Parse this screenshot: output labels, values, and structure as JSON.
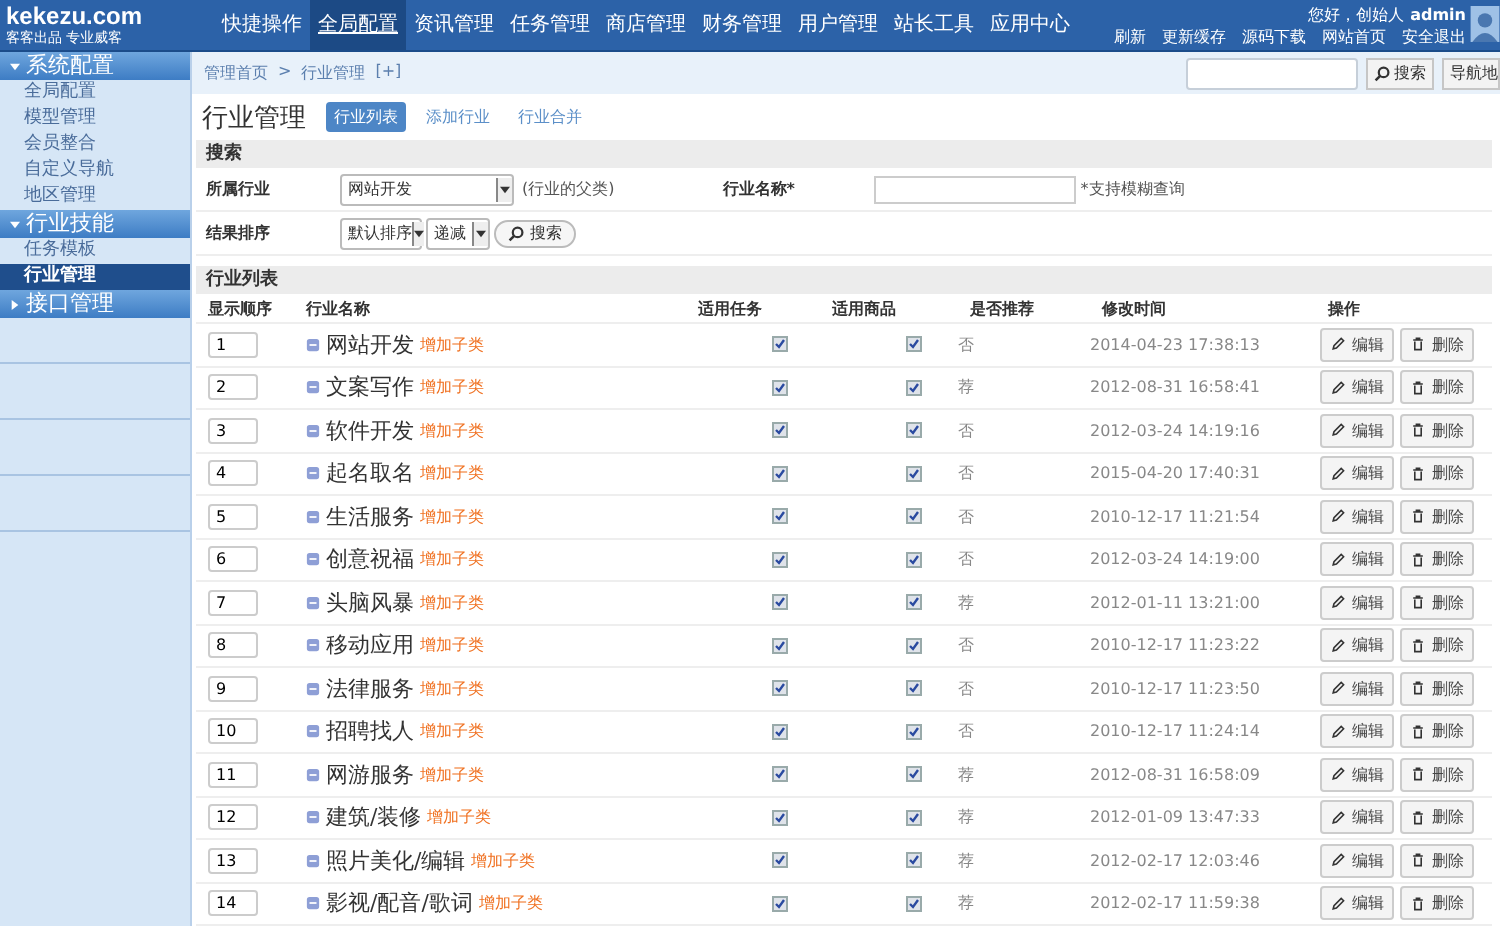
{
  "header": {
    "logo": {
      "name": "kekezu.com",
      "tagline": "客客出品 专业威客"
    },
    "nav": [
      {
        "label": "快捷操作",
        "selected": false
      },
      {
        "label": "全局配置",
        "selected": true
      },
      {
        "label": "资讯管理",
        "selected": false
      },
      {
        "label": "任务管理",
        "selected": false
      },
      {
        "label": "商店管理",
        "selected": false
      },
      {
        "label": "财务管理",
        "selected": false
      },
      {
        "label": "用户管理",
        "selected": false
      },
      {
        "label": "站长工具",
        "selected": false
      },
      {
        "label": "应用中心",
        "selected": false
      }
    ],
    "greeting": "您好，创始人",
    "user": "admin",
    "links": [
      "刷新",
      "更新缓存",
      "源码下载",
      "网站首页",
      "安全退出"
    ]
  },
  "sidebar": [
    {
      "title": "系统配置",
      "expanded": true,
      "items": [
        {
          "label": "全局配置",
          "selected": false
        },
        {
          "label": "模型管理",
          "selected": false
        },
        {
          "label": "会员整合",
          "selected": false
        },
        {
          "label": "自定义导航",
          "selected": false
        },
        {
          "label": "地区管理",
          "selected": false
        }
      ]
    },
    {
      "title": "行业技能",
      "expanded": true,
      "items": [
        {
          "label": "任务模板",
          "selected": false
        },
        {
          "label": "行业管理",
          "selected": true
        }
      ]
    },
    {
      "title": "接口管理",
      "expanded": false
    }
  ],
  "breadcrumb": {
    "items": [
      "管理首页",
      "行业管理"
    ],
    "separator": ">",
    "add": "[+]"
  },
  "top_search": {
    "button": "搜索",
    "nav_button": "导航地"
  },
  "page": {
    "title": "行业管理",
    "tabs": [
      {
        "label": "行业列表",
        "selected": true
      },
      {
        "label": "添加行业",
        "selected": false
      },
      {
        "label": "行业合并",
        "selected": false
      }
    ]
  },
  "search": {
    "title": "搜索",
    "industry_label": "所属行业",
    "industry_value": "网站开发",
    "industry_hint": "(行业的父类)",
    "name_label": "行业名称*",
    "name_hint": "*支持模糊查询",
    "sort_label": "结果排序",
    "sort_value": "默认排序",
    "order_value": "递减",
    "button": "搜索"
  },
  "list": {
    "title": "行业列表",
    "columns": [
      "显示顺序",
      "行业名称",
      "适用任务",
      "适用商品",
      "是否推荐",
      "修改时间",
      "操作"
    ],
    "rows": [
      {
        "order": "1",
        "name": "网站开发",
        "add_child": "增加子类",
        "task": true,
        "goods": true,
        "recommend": "否",
        "time": "2014-04-23 17:38:13",
        "edit": "编辑",
        "delete": "删除"
      },
      {
        "order": "2",
        "name": "文案写作",
        "add_child": "增加子类",
        "task": true,
        "goods": true,
        "recommend": "荐",
        "time": "2012-08-31 16:58:41",
        "edit": "编辑",
        "delete": "删除"
      },
      {
        "order": "3",
        "name": "软件开发",
        "add_child": "增加子类",
        "task": true,
        "goods": true,
        "recommend": "否",
        "time": "2012-03-24 14:19:16",
        "edit": "编辑",
        "delete": "删除"
      },
      {
        "order": "4",
        "name": "起名取名",
        "add_child": "增加子类",
        "task": true,
        "goods": true,
        "recommend": "否",
        "time": "2015-04-20 17:40:31",
        "edit": "编辑",
        "delete": "删除"
      },
      {
        "order": "5",
        "name": "生活服务",
        "add_child": "增加子类",
        "task": true,
        "goods": true,
        "recommend": "否",
        "time": "2010-12-17 11:21:54",
        "edit": "编辑",
        "delete": "删除"
      },
      {
        "order": "6",
        "name": "创意祝福",
        "add_child": "增加子类",
        "task": true,
        "goods": true,
        "recommend": "否",
        "time": "2012-03-24 14:19:00",
        "edit": "编辑",
        "delete": "删除"
      },
      {
        "order": "7",
        "name": "头脑风暴",
        "add_child": "增加子类",
        "task": true,
        "goods": true,
        "recommend": "荐",
        "time": "2012-01-11 13:21:00",
        "edit": "编辑",
        "delete": "删除"
      },
      {
        "order": "8",
        "name": "移动应用",
        "add_child": "增加子类",
        "task": true,
        "goods": true,
        "recommend": "否",
        "time": "2010-12-17 11:23:22",
        "edit": "编辑",
        "delete": "删除"
      },
      {
        "order": "9",
        "name": "法律服务",
        "add_child": "增加子类",
        "task": true,
        "goods": true,
        "recommend": "否",
        "time": "2010-12-17 11:23:50",
        "edit": "编辑",
        "delete": "删除"
      },
      {
        "order": "10",
        "name": "招聘找人",
        "add_child": "增加子类",
        "task": true,
        "goods": true,
        "recommend": "否",
        "time": "2010-12-17 11:24:14",
        "edit": "编辑",
        "delete": "删除"
      },
      {
        "order": "11",
        "name": "网游服务",
        "add_child": "增加子类",
        "task": true,
        "goods": true,
        "recommend": "荐",
        "time": "2012-08-31 16:58:09",
        "edit": "编辑",
        "delete": "删除"
      },
      {
        "order": "12",
        "name": "建筑/装修",
        "add_child": "增加子类",
        "task": true,
        "goods": true,
        "recommend": "荐",
        "time": "2012-01-09 13:47:33",
        "edit": "编辑",
        "delete": "删除"
      },
      {
        "order": "13",
        "name": "照片美化/编辑",
        "add_child": "增加子类",
        "task": true,
        "goods": true,
        "recommend": "荐",
        "time": "2012-02-17 12:03:46",
        "edit": "编辑",
        "delete": "删除"
      },
      {
        "order": "14",
        "name": "影视/配音/歌词",
        "add_child": "增加子类",
        "task": true,
        "goods": true,
        "recommend": "荐",
        "time": "2012-02-17 11:59:38",
        "edit": "编辑",
        "delete": "删除"
      }
    ]
  }
}
